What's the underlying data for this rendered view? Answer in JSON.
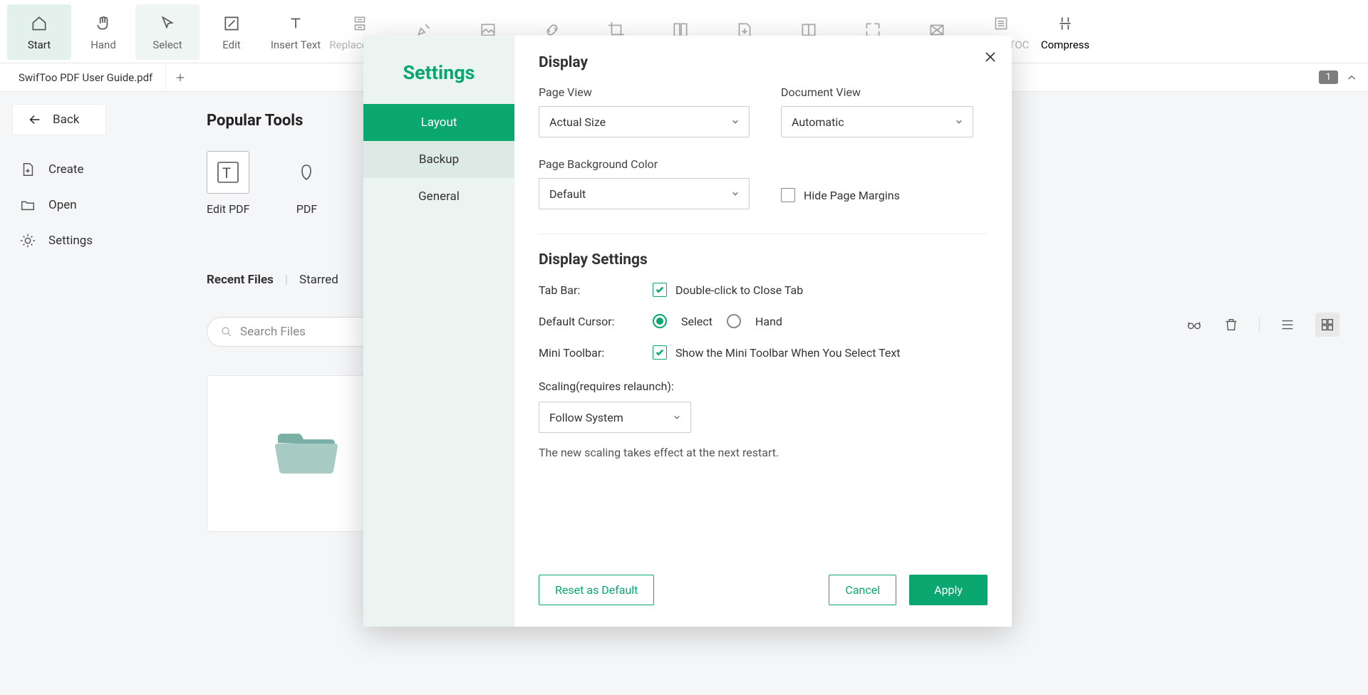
{
  "toolbar": [
    {
      "label": "Start",
      "icon": "home",
      "active": true
    },
    {
      "label": "Hand",
      "icon": "hand"
    },
    {
      "label": "Select",
      "icon": "cursor",
      "selected": true
    },
    {
      "label": "Edit",
      "icon": "edit-box"
    },
    {
      "label": "Insert Text",
      "icon": "text-t"
    },
    {
      "label": "Replace Text",
      "icon": "replace"
    },
    {
      "label": "Highlight",
      "icon": "highlight"
    },
    {
      "label": "Image",
      "icon": "image"
    },
    {
      "label": "Link",
      "icon": "link"
    },
    {
      "label": "Crop Page",
      "icon": "crop"
    },
    {
      "label": "Split",
      "icon": "split"
    },
    {
      "label": "Extract Page",
      "icon": "extract"
    },
    {
      "label": "Replace Page",
      "icon": "replace-page"
    },
    {
      "label": "OCR",
      "icon": "ocr"
    },
    {
      "label": "Flatten",
      "icon": "flatten"
    },
    {
      "label": "Extract TOC",
      "icon": "toc"
    },
    {
      "label": "Compress",
      "icon": "compress",
      "black": true
    }
  ],
  "tab": {
    "title": "SwifToo PDF User Guide.pdf",
    "page": "1"
  },
  "sidebar": {
    "back": "Back",
    "items": [
      {
        "label": "Create",
        "icon": "file-plus"
      },
      {
        "label": "Open",
        "icon": "folder"
      },
      {
        "label": "Settings",
        "icon": "gear"
      }
    ]
  },
  "content": {
    "popular_title": "Popular Tools",
    "tools": [
      {
        "label": "Edit PDF"
      },
      {
        "label": "PDF"
      }
    ],
    "recent": "Recent Files",
    "starred": "Starred",
    "search_placeholder": "Search Files"
  },
  "settings": {
    "title": "Settings",
    "nav": [
      {
        "label": "Layout",
        "active": true
      },
      {
        "label": "Backup",
        "hov": true
      },
      {
        "label": "General"
      }
    ],
    "display": {
      "heading": "Display",
      "page_view_label": "Page View",
      "page_view_value": "Actual Size",
      "doc_view_label": "Document View",
      "doc_view_value": "Automatic",
      "bg_color_label": "Page Background Color",
      "bg_color_value": "Default",
      "hide_margins": "Hide Page Margins"
    },
    "display_settings": {
      "heading": "Display Settings",
      "tab_bar_label": "Tab Bar:",
      "tab_bar_opt": "Double-click to Close Tab",
      "cursor_label": "Default Cursor:",
      "cursor_select": "Select",
      "cursor_hand": "Hand",
      "mini_label": "Mini Toolbar:",
      "mini_opt": "Show the Mini Toolbar When You Select Text",
      "scaling_label": "Scaling(requires relaunch):",
      "scaling_value": "Follow System",
      "scaling_hint": "The new scaling takes effect at the next restart."
    },
    "footer": {
      "reset": "Reset as Default",
      "cancel": "Cancel",
      "apply": "Apply"
    }
  }
}
